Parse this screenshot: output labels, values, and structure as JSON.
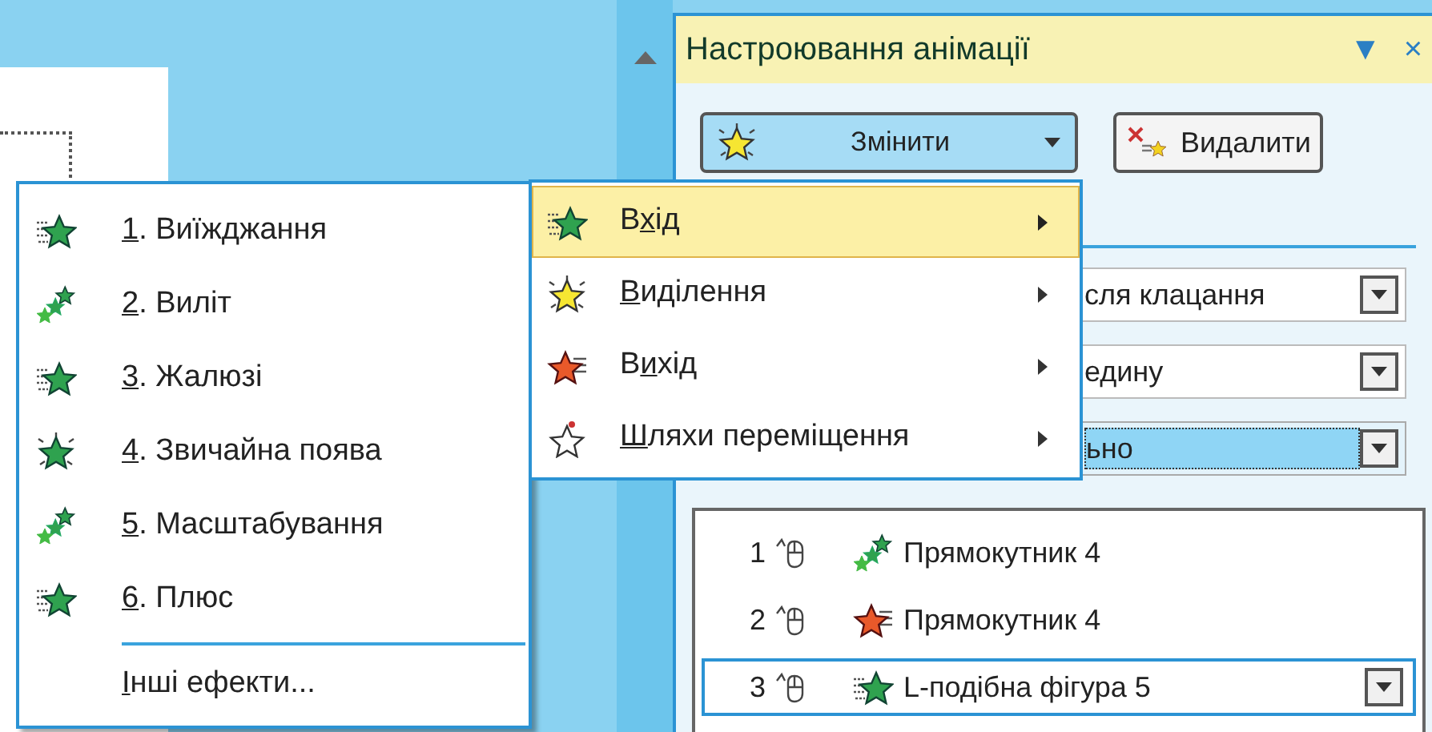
{
  "task_pane": {
    "title": "Настроювання анімації",
    "title_buttons": [
      "▼",
      "×"
    ],
    "buttons": [
      {
        "label": "Змінити",
        "kind": "change"
      },
      {
        "label": "Видалити",
        "kind": "delete"
      }
    ],
    "fields": [
      {
        "value": "сля клацання",
        "selected": false
      },
      {
        "value": "едину",
        "selected": false
      },
      {
        "value": "ьно",
        "selected": true
      }
    ],
    "animation_list": [
      {
        "order": "1",
        "name": "Прямокутник 4",
        "kind": "fly",
        "selected": false
      },
      {
        "order": "2",
        "name": "Прямокутник 4",
        "kind": "exit",
        "selected": false
      },
      {
        "order": "3",
        "name": "L-подібна фігура 5",
        "kind": "enter",
        "selected": true
      }
    ]
  },
  "effect_types_menu": {
    "items": [
      {
        "pre": "В",
        "key": "х",
        "post": "ід",
        "kind": "enter",
        "selected": true
      },
      {
        "key": "В",
        "post": "иділення",
        "kind": "emphasis",
        "selected": false
      },
      {
        "pre": "В",
        "key": "и",
        "post": "хід",
        "kind": "exit",
        "selected": false
      },
      {
        "key": "Ш",
        "post": "ляхи переміщення",
        "kind": "path",
        "selected": false
      }
    ]
  },
  "effects_menu": {
    "items": [
      {
        "key": "1",
        "post": ". Виїжджання",
        "kind": "enter"
      },
      {
        "key": "2",
        "post": ". Виліт",
        "kind": "fly"
      },
      {
        "key": "3",
        "post": ". Жалюзі",
        "kind": "enter"
      },
      {
        "key": "4",
        "post": ". Звичайна поява",
        "kind": "appear"
      },
      {
        "key": "5",
        "post": ". Масштабування",
        "kind": "fly"
      },
      {
        "key": "6",
        "post": ". Плюс",
        "kind": "enter"
      }
    ],
    "more": {
      "key": "І",
      "post": "нші ефекти..."
    }
  }
}
